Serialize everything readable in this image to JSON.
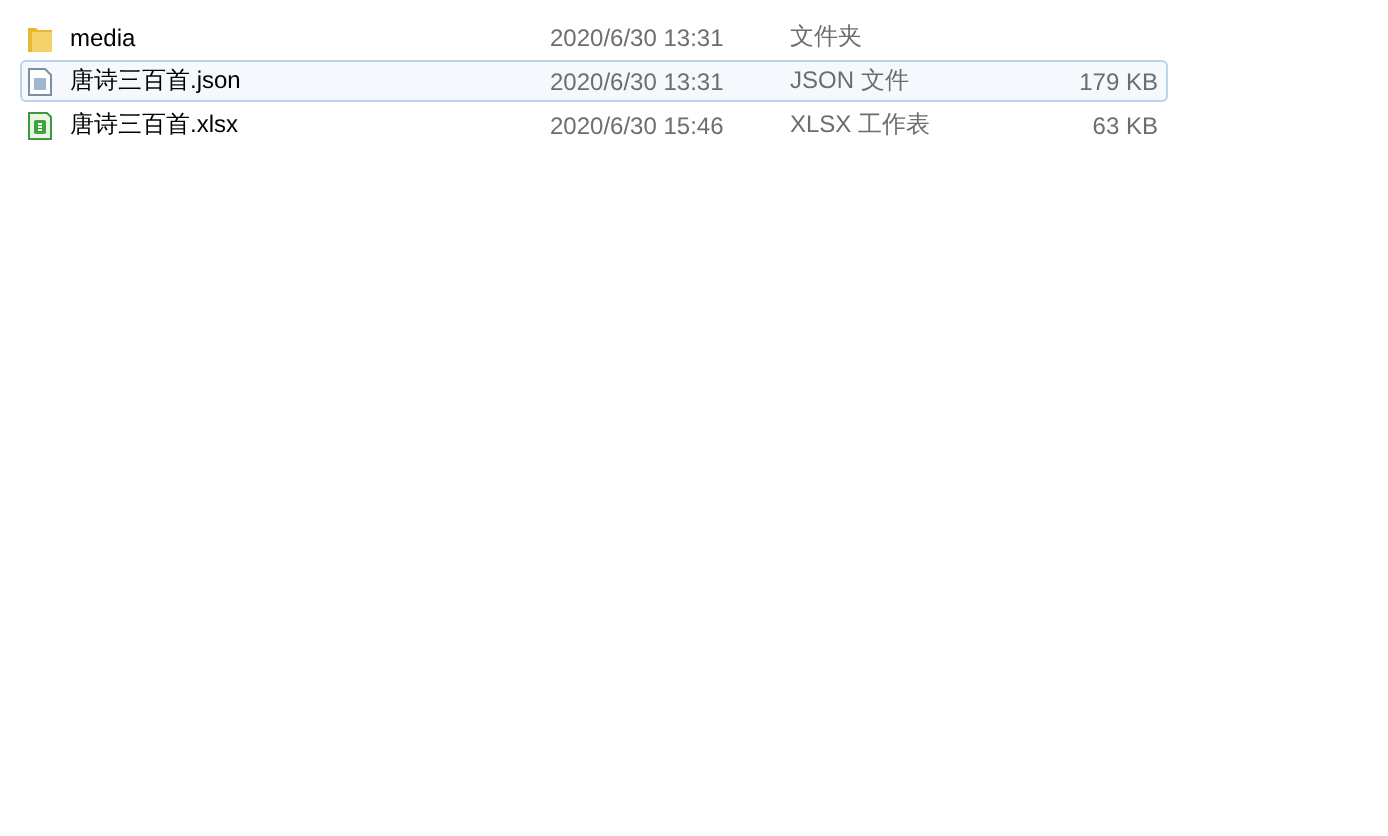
{
  "files": [
    {
      "kind": "folder",
      "name": "media",
      "modified": "2020/6/30 13:31",
      "type": "文件夹",
      "selected": false
    },
    {
      "kind": "json",
      "name": "唐诗三百首.json",
      "modified": "2020/6/30 13:31",
      "type": "JSON 文件",
      "size": "179 KB",
      "selected": true
    },
    {
      "kind": "xlsx",
      "name": "唐诗三百首.xlsx",
      "modified": "2020/6/30 15:46",
      "type": "XLSX 工作表",
      "size": "63 KB",
      "selected": false
    }
  ]
}
